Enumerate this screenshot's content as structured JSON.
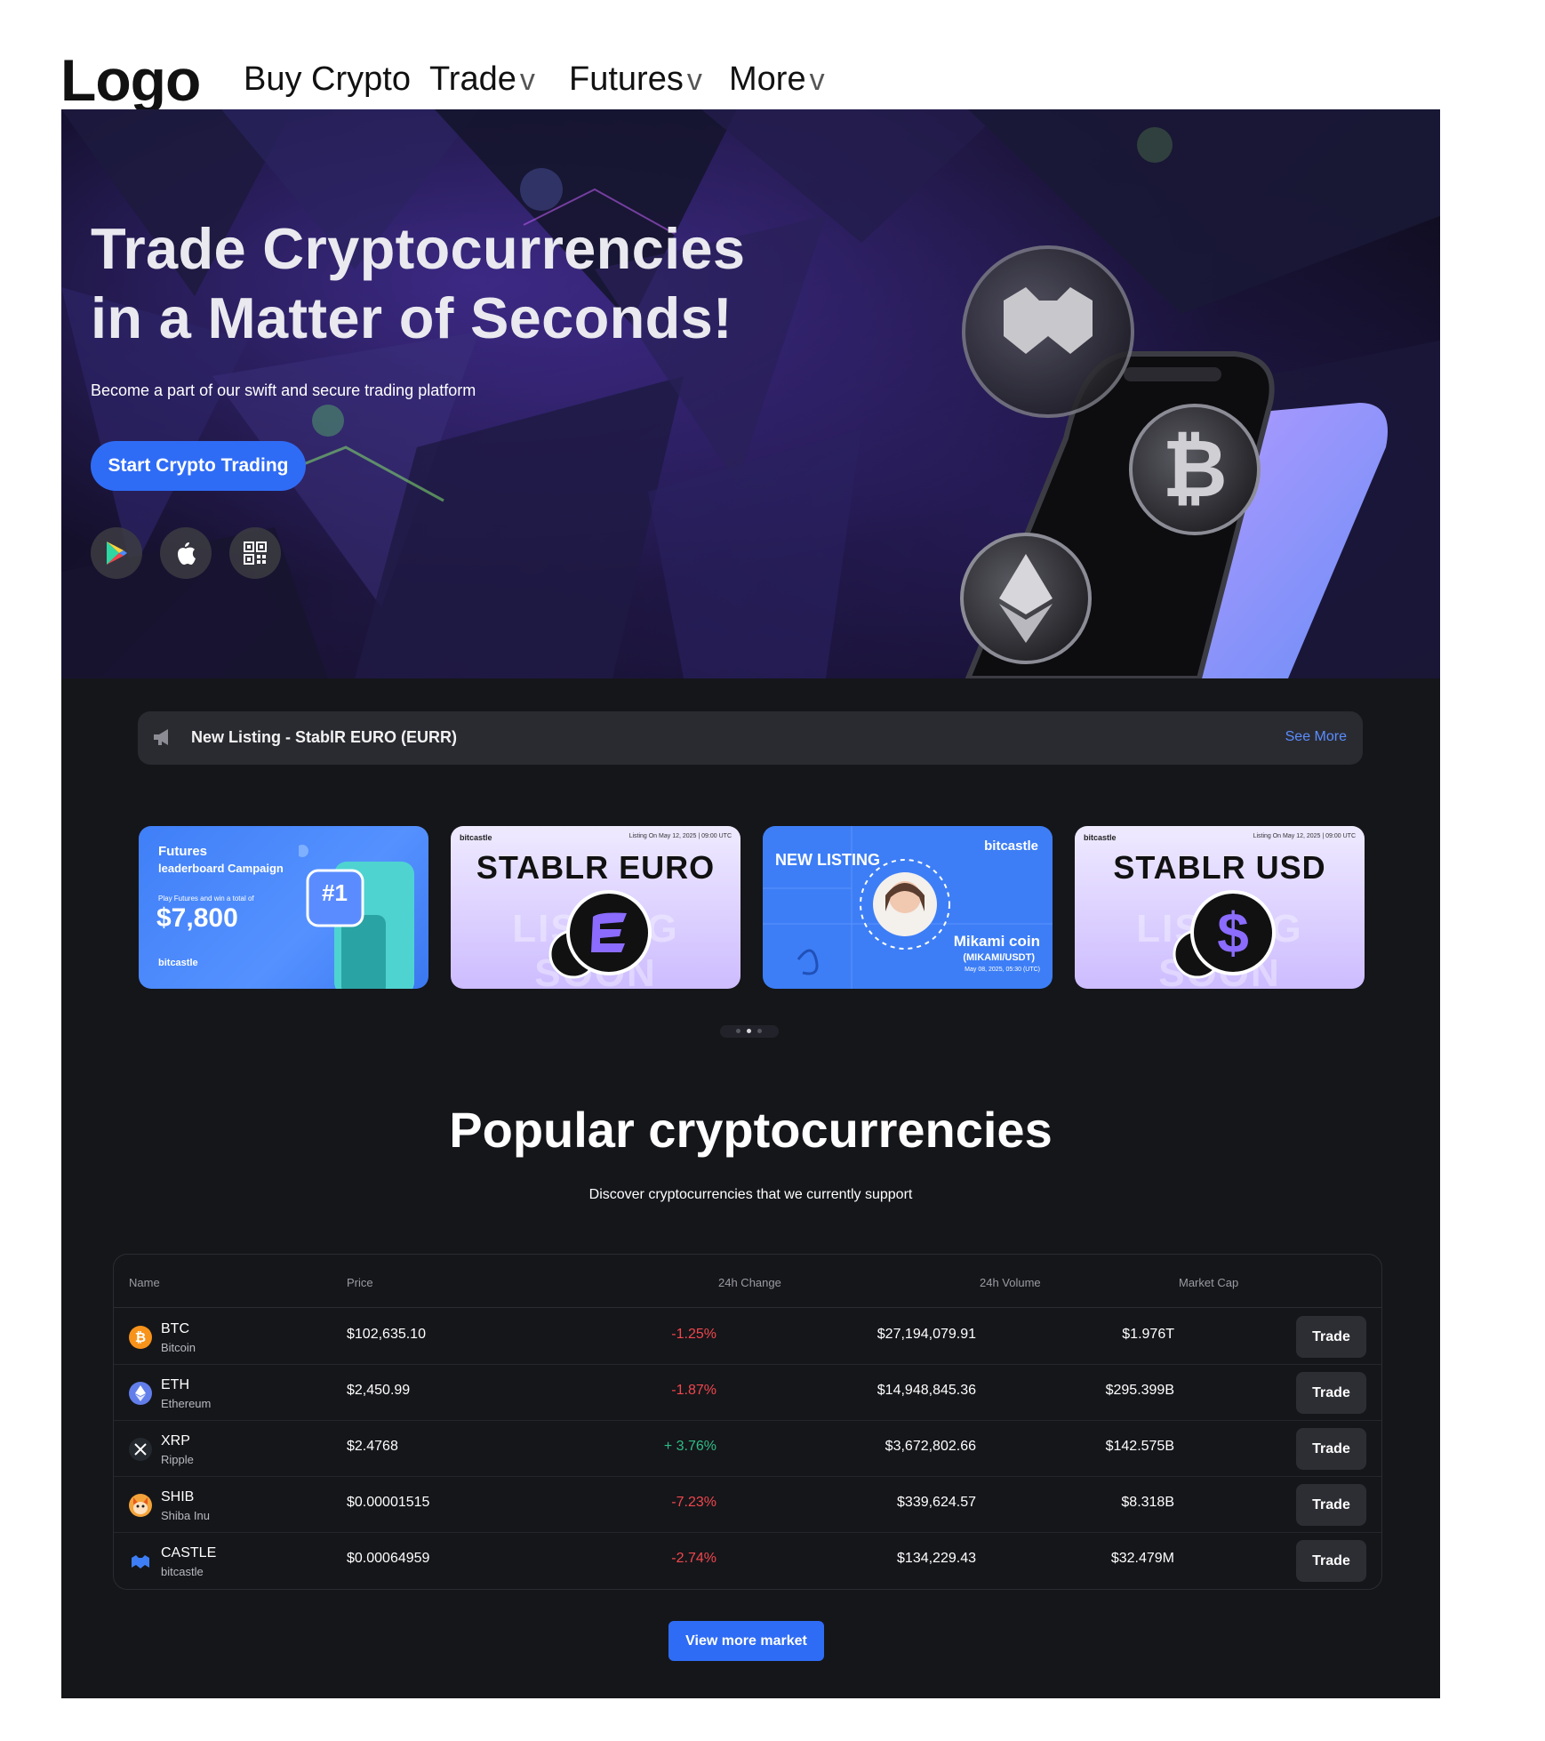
{
  "nav": {
    "logo": "Logo",
    "items": [
      {
        "label": "Buy Crypto",
        "chevron": ""
      },
      {
        "label": "Trade",
        "chevron": "v"
      },
      {
        "label": "Futures",
        "chevron": "v"
      },
      {
        "label": "More",
        "chevron": "v"
      }
    ]
  },
  "hero": {
    "title_line1": "Trade Cryptocurrencies",
    "title_line2": "in a Matter of Seconds!",
    "subtitle": "Become a part of our swift and secure trading platform",
    "cta": "Start Crypto Trading",
    "store_icons": [
      "google-play-icon",
      "apple-icon",
      "qr-code-icon"
    ]
  },
  "announcement": {
    "icon": "megaphone-icon",
    "text": "New Listing - StablR EURO (EURR)",
    "link": "See More"
  },
  "banners": [
    {
      "line1": "Futures",
      "line2": "leaderboard Campaign",
      "line3": "Play Futures and win a total of",
      "amount": "$7,800",
      "badge": "#1",
      "brand": "bitcastle"
    },
    {
      "brand": "bitcastle",
      "date": "Listing On May 12, 2025 | 09:00 UTC",
      "title": "STABLR EURO",
      "ghost": "LISTING SOON"
    },
    {
      "tag": "NEW LISTING",
      "brand": "bitcastle",
      "coin": "Mikami coin",
      "pair": "(MIKAMI/USDT)",
      "date": "May 08, 2025, 05:30 (UTC)"
    },
    {
      "brand": "bitcastle",
      "date": "Listing On May 12, 2025 | 09:00 UTC",
      "title": "STABLR USD",
      "ghost": "LISTING SOON"
    }
  ],
  "section": {
    "title": "Popular cryptocurrencies",
    "subtitle": "Discover cryptocurrencies that we currently support"
  },
  "table": {
    "headers": {
      "name": "Name",
      "price": "Price",
      "change": "24h Change",
      "volume": "24h Volume",
      "cap": "Market Cap"
    },
    "rows": [
      {
        "symbol": "BTC",
        "name": "Bitcoin",
        "price": "$102,635.10",
        "change": "-1.25%",
        "change_dir": "down",
        "volume": "$27,194,079.91",
        "cap": "$1.976T",
        "action": "Trade",
        "icon_color": "#f7931a"
      },
      {
        "symbol": "ETH",
        "name": "Ethereum",
        "price": "$2,450.99",
        "change": "-1.87%",
        "change_dir": "down",
        "volume": "$14,948,845.36",
        "cap": "$295.399B",
        "action": "Trade",
        "icon_color": "#627eea"
      },
      {
        "symbol": "XRP",
        "name": "Ripple",
        "price": "$2.4768",
        "change": "+ 3.76%",
        "change_dir": "up",
        "volume": "$3,672,802.66",
        "cap": "$142.575B",
        "action": "Trade",
        "icon_color": "#23292f"
      },
      {
        "symbol": "SHIB",
        "name": "Shiba Inu",
        "price": "$0.00001515",
        "change": "-7.23%",
        "change_dir": "down",
        "volume": "$339,624.57",
        "cap": "$8.318B",
        "action": "Trade",
        "icon_color": "#e85a1b"
      },
      {
        "symbol": "CASTLE",
        "name": "bitcastle",
        "price": "$0.00064959",
        "change": "-2.74%",
        "change_dir": "down",
        "volume": "$134,229.43",
        "cap": "$32.479M",
        "action": "Trade",
        "icon_color": "#3d7ef6"
      }
    ]
  },
  "view_more": "View more market",
  "colors": {
    "accent": "#2f6cf5",
    "page_bg": "#15161a",
    "down": "#f0474d",
    "up": "#2ebd85"
  }
}
